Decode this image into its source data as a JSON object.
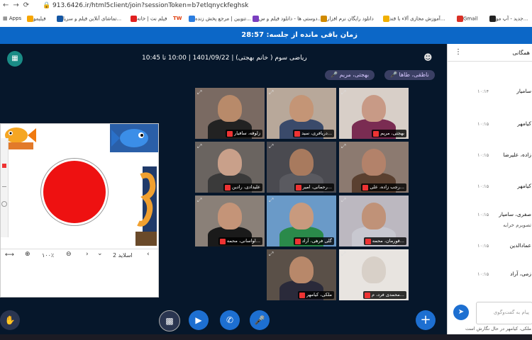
{
  "browser": {
    "url": "913.6426.ir/html5client/join?sessionToken=b7etlqnyckfeghsk",
    "apps_label": "Apps",
    "bookmarks": [
      {
        "label": "فیلیمو",
        "color": "#f7a600"
      },
      {
        "label": "تماشای آنلاین فیلم و سریا...",
        "color": "#1456a3"
      },
      {
        "label": "فیلم نت | خانه",
        "color": "#e02020"
      },
      {
        "label": "TW",
        "color": "#e04010"
      },
      {
        "label": "تنوبین | مرجع پخش زنده...",
        "color": "#2b7de0"
      },
      {
        "label": "دوستی ها - دانلود فیلم و س...",
        "color": "#7a3fbf"
      },
      {
        "label": "دانلود رایگان نرم افزار",
        "color": "#d08a00"
      },
      {
        "label": "آموزش مجازی آلاء با قند...",
        "color": "#f1b000"
      },
      {
        "label": "Gmail",
        "color": "#d93025"
      },
      {
        "label": "جدید - آپ مو...",
        "color": "#222222"
      }
    ]
  },
  "banner": {
    "timer_text": "زمان باقی مانده از جلسه: 28:57"
  },
  "meeting": {
    "title": "ریاضی سوم ( خانم بهجتی) | 1401/09/22 | 10:00 تا 10:45",
    "badges": [
      "ناظقی، طاها",
      "بهجتی، مریم"
    ]
  },
  "presentation": {
    "slide_label": "اسلاید 2",
    "zoom": "۱۰۰٪"
  },
  "tiles": [
    {
      "name": "بهجتی، مریم",
      "skin": "#c89a86",
      "shirt": "#7a2c52",
      "bg": "#d8cfc8"
    },
    {
      "name": "دریافری، سید...",
      "skin": "#c49576",
      "shirt": "#3a4a6a",
      "bg": "#b8a89a"
    },
    {
      "name": "زلوفه، سافیار",
      "skin": "#b88a6a",
      "shirt": "#222",
      "bg": "#7a6a62"
    },
    {
      "name": "رجب زاده، علی...",
      "skin": "#b3826a",
      "shirt": "#5a4030",
      "bg": "#8c7a70"
    },
    {
      "name": "رحمانی، امیر...",
      "skin": "#a87a5e",
      "shirt": "#5a5a60",
      "bg": "#4a4a50"
    },
    {
      "name": "علیدادی، رادین",
      "skin": "#c9a08a",
      "shirt": "#3a3a3a",
      "bg": "#6a6460"
    },
    {
      "name": "قورمان، محمه...",
      "skin": "#c09278",
      "shirt": "#c8c8d0",
      "bg": "#bcb8c0"
    },
    {
      "name": "گلی فرهی، آراد",
      "skin": "#c89a7e",
      "shirt": "#2a8a4a",
      "bg": "#6a9ac8"
    },
    {
      "name": "لواسانی، محمه...",
      "skin": "#c49478",
      "shirt": "#1a1a1a",
      "bg": "#8a8078"
    },
    {
      "name": "محمدی فرد، م...",
      "skin": "#d8d0c8",
      "shirt": "#e8e4e0",
      "bg": "#e8e4e0"
    },
    {
      "name": "ملکی، کیامهر",
      "skin": "#b8886a",
      "shirt": "#2a2a3a",
      "bg": "#5a5048"
    }
  ],
  "chat": {
    "header": "همگانی",
    "messages": [
      {
        "name": "سامیار",
        "time": "۱۰:۱۴"
      },
      {
        "name": "کیامهر",
        "time": "۱۰:۱۵"
      },
      {
        "name": "زاده، علیرضا",
        "time": "۱۰:۱۵"
      },
      {
        "name": "کیامهر",
        "time": "۱۰:۱۵"
      },
      {
        "name": "صفری، سامیار",
        "time": "۱۰:۱۵"
      },
      {
        "name": "تصویرم خرابه",
        "time": ""
      },
      {
        "name": "عمادالدین",
        "time": "۱۰:۱۵"
      },
      {
        "name": "زمی، آراد",
        "time": "۱۰:۱۵"
      }
    ],
    "input_placeholder": "پیام به گفت‌وگوی",
    "typing_text": "ملکی، کیامهر در حال نگارش است"
  },
  "colors": {
    "app_bg": "#06172b",
    "accent": "#1d6fd1",
    "banner": "#0c67c7"
  }
}
